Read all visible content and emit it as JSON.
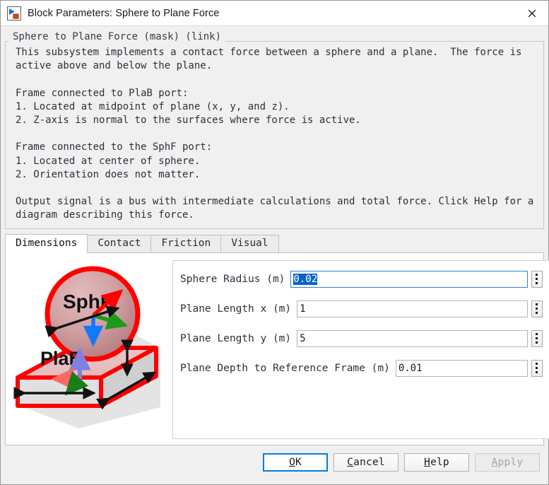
{
  "window": {
    "title": "Block Parameters: Sphere to Plane Force",
    "icon": "simulink-block-icon",
    "close_icon": "close-icon"
  },
  "description": {
    "legend": "Sphere to Plane Force (mask) (link)",
    "body": "This subsystem implements a contact force between a sphere and a plane.  The force is\nactive above and below the plane.\n\nFrame connected to PlaB port:\n1. Located at midpoint of plane (x, y, and z).\n2. Z-axis is normal to the surfaces where force is active.\n\nFrame connected to the SphF port:\n1. Located at center of sphere.\n2. Orientation does not matter.\n\nOutput signal is a bus with intermediate calculations and total force. Click Help for a\ndiagram describing this force."
  },
  "tabs": [
    {
      "label": "Dimensions",
      "active": true
    },
    {
      "label": "Contact",
      "active": false
    },
    {
      "label": "Friction",
      "active": false
    },
    {
      "label": "Visual",
      "active": false
    }
  ],
  "mask_diagram": {
    "name": "sphere-to-plane-force-diagram",
    "sphere_label": "SphF",
    "plane_label": "PlaB",
    "colors": {
      "outline": "#ff0000",
      "sphere_fill": "#cc9a9c",
      "plane_top": "#eec2c2",
      "plane_side": "#d8d8d8",
      "arrow_x": "#ff5555",
      "arrow_y": "#1a9c1a",
      "arrow_z": "#8080e0",
      "sphere_arrow_blue": "#1478ff",
      "sphere_arrow_green": "#1a9c1a",
      "sphere_arrow_red": "#ff0000",
      "dim_arrow": "#000000"
    }
  },
  "parameters": [
    {
      "label": "Sphere Radius (m)",
      "value": "0.02",
      "focused": true,
      "selected": true,
      "spinner": "options-spinner"
    },
    {
      "label": "Plane Length x (m)",
      "value": "1",
      "focused": false,
      "selected": false,
      "spinner": "options-spinner"
    },
    {
      "label": "Plane Length y (m)",
      "value": "5",
      "focused": false,
      "selected": false,
      "spinner": "options-spinner"
    },
    {
      "label": "Plane Depth to Reference Frame (m)",
      "value": "0.01",
      "focused": false,
      "selected": false,
      "spinner": "options-spinner"
    }
  ],
  "footer_buttons": [
    {
      "label": "OK",
      "mnemonic": "O",
      "default": true,
      "disabled": false
    },
    {
      "label": "Cancel",
      "mnemonic": "C",
      "default": false,
      "disabled": false
    },
    {
      "label": "Help",
      "mnemonic": "H",
      "default": false,
      "disabled": false
    },
    {
      "label": "Apply",
      "mnemonic": "A",
      "default": false,
      "disabled": true
    }
  ],
  "colors": {
    "accent": "#0a7cd8",
    "selection": "#0a64c8",
    "dialog_bg": "#f0f0f0",
    "panel_bg": "#ffffff"
  }
}
